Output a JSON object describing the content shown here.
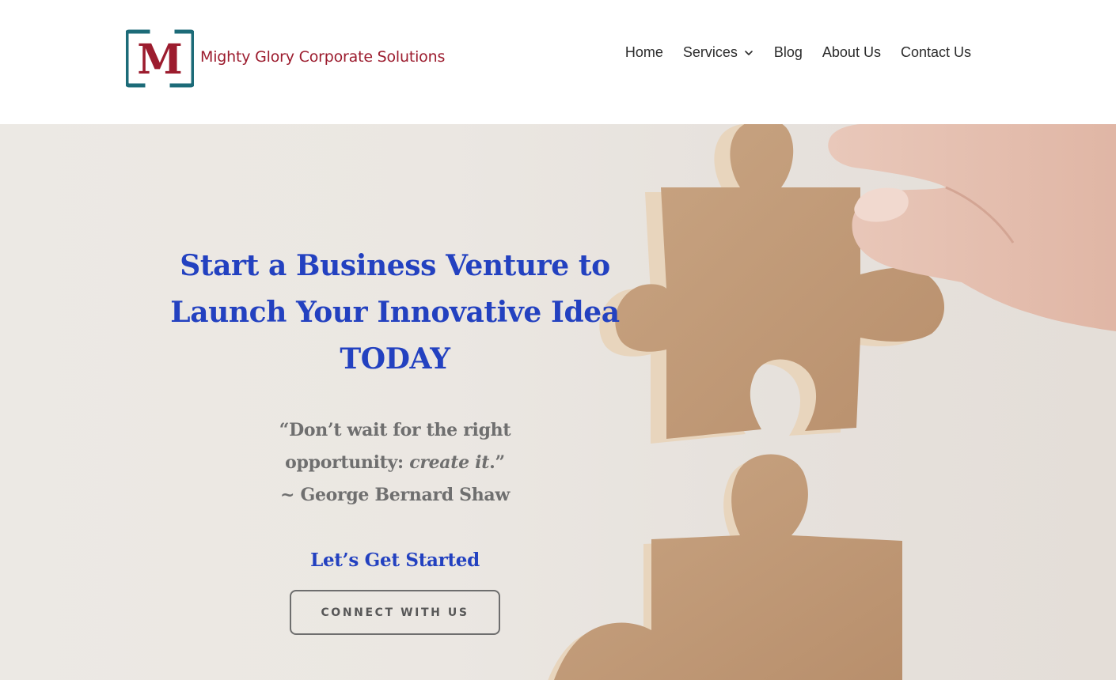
{
  "header": {
    "logo": {
      "letter": "M",
      "text": "Mighty Glory Corporate Solutions",
      "colors": {
        "frame": "#1c6b78",
        "letter": "#9c1c2e",
        "text": "#9c1c2e"
      }
    },
    "nav": [
      {
        "label": "Home"
      },
      {
        "label": "Services",
        "icon": "chevron-down-icon"
      },
      {
        "label": "Blog"
      },
      {
        "label": "About Us"
      },
      {
        "label": "Contact Us"
      }
    ]
  },
  "hero": {
    "title_lines": [
      "Start a Business Venture to",
      "Launch Your Innovative Idea",
      "TODAY"
    ],
    "quote": {
      "line1": "“Don’t wait for the right",
      "line2_prefix": "opportunity: ",
      "line2_emphasis": "create it",
      "line2_suffix": ".”",
      "author": "~ George Bernard Shaw"
    },
    "cta_heading": "Let’s Get Started",
    "cta_button": "CONNECT WITH US",
    "image": "hand-holding-puzzle-piece",
    "colors": {
      "heading": "#2341c0",
      "quote": "#6f6f6f",
      "button_border": "#6e6e6e"
    }
  }
}
